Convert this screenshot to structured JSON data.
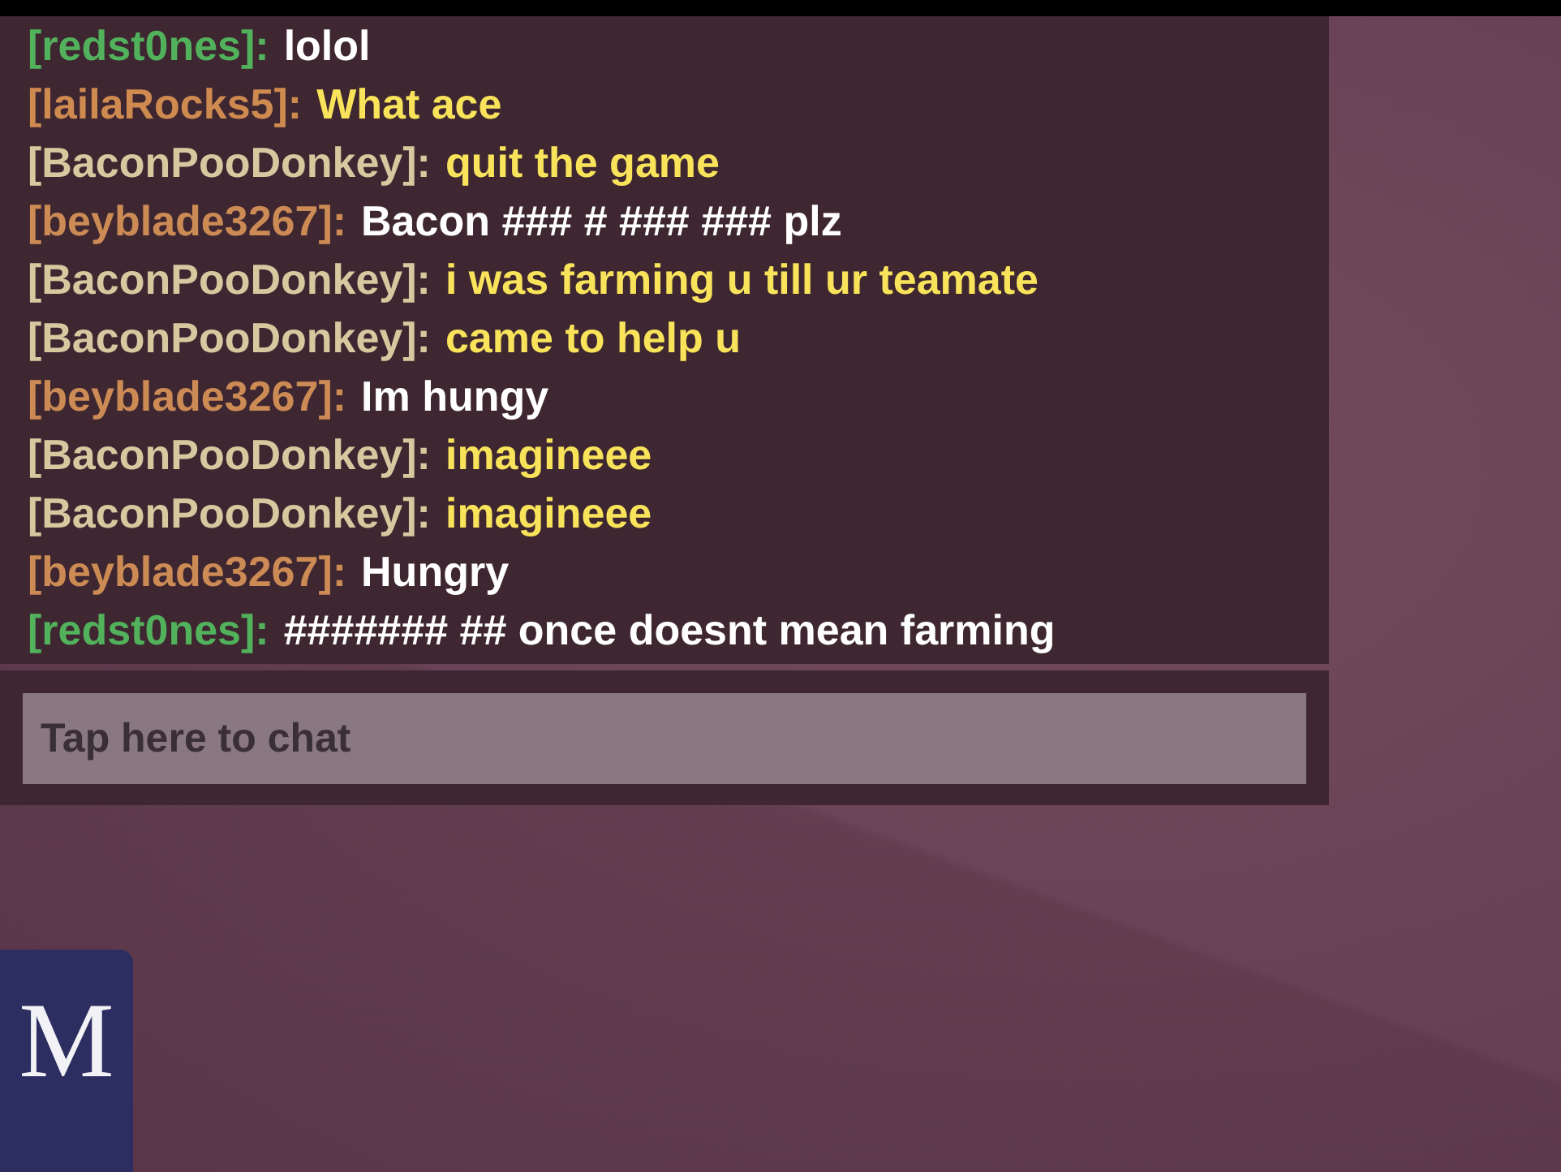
{
  "chat": {
    "messages": [
      {
        "user": {
          "text": "[redst0nes]:",
          "color": "#52b25c"
        },
        "body": {
          "text": "lolol",
          "color": "#ffffff"
        }
      },
      {
        "user": {
          "text": "[lailaRocks5]:",
          "color": "#cf8a50"
        },
        "body": {
          "text": "What ace",
          "color": "#f8e35a"
        }
      },
      {
        "user": {
          "text": "[BaconPooDonkey]:",
          "color": "#d6c89f"
        },
        "body": {
          "text": "quit the game",
          "color": "#f8e35a"
        }
      },
      {
        "user": {
          "text": "[beyblade3267]:",
          "color": "#cc8a54"
        },
        "body": {
          "text": "Bacon ### # ### ### plz",
          "color": "#ffffff"
        }
      },
      {
        "user": {
          "text": "[BaconPooDonkey]:",
          "color": "#d6c89f"
        },
        "body": {
          "text": "i was farming u till ur teamate",
          "color": "#f8e35a"
        }
      },
      {
        "user": {
          "text": "[BaconPooDonkey]:",
          "color": "#d6c89f"
        },
        "body": {
          "text": "came to help u",
          "color": "#f8e35a"
        }
      },
      {
        "user": {
          "text": "[beyblade3267]:",
          "color": "#cc8a54"
        },
        "body": {
          "text": "Im hungy",
          "color": "#ffffff"
        }
      },
      {
        "user": {
          "text": "[BaconPooDonkey]:",
          "color": "#d6c89f"
        },
        "body": {
          "text": "imagineee",
          "color": "#f8e35a"
        }
      },
      {
        "user": {
          "text": "[BaconPooDonkey]:",
          "color": "#d6c89f"
        },
        "body": {
          "text": "imagineee",
          "color": "#f8e35a"
        }
      },
      {
        "user": {
          "text": "[beyblade3267]:",
          "color": "#cc8a54"
        },
        "body": {
          "text": "Hungry",
          "color": "#ffffff"
        }
      },
      {
        "user": {
          "text": "[redst0nes]:",
          "color": "#52b25c"
        },
        "body": {
          "text": "####### ## once doesnt mean farming",
          "color": "#ffffff"
        }
      }
    ]
  },
  "chat_input": {
    "placeholder": "Tap here to chat"
  },
  "side_tab": {
    "text": "M"
  }
}
